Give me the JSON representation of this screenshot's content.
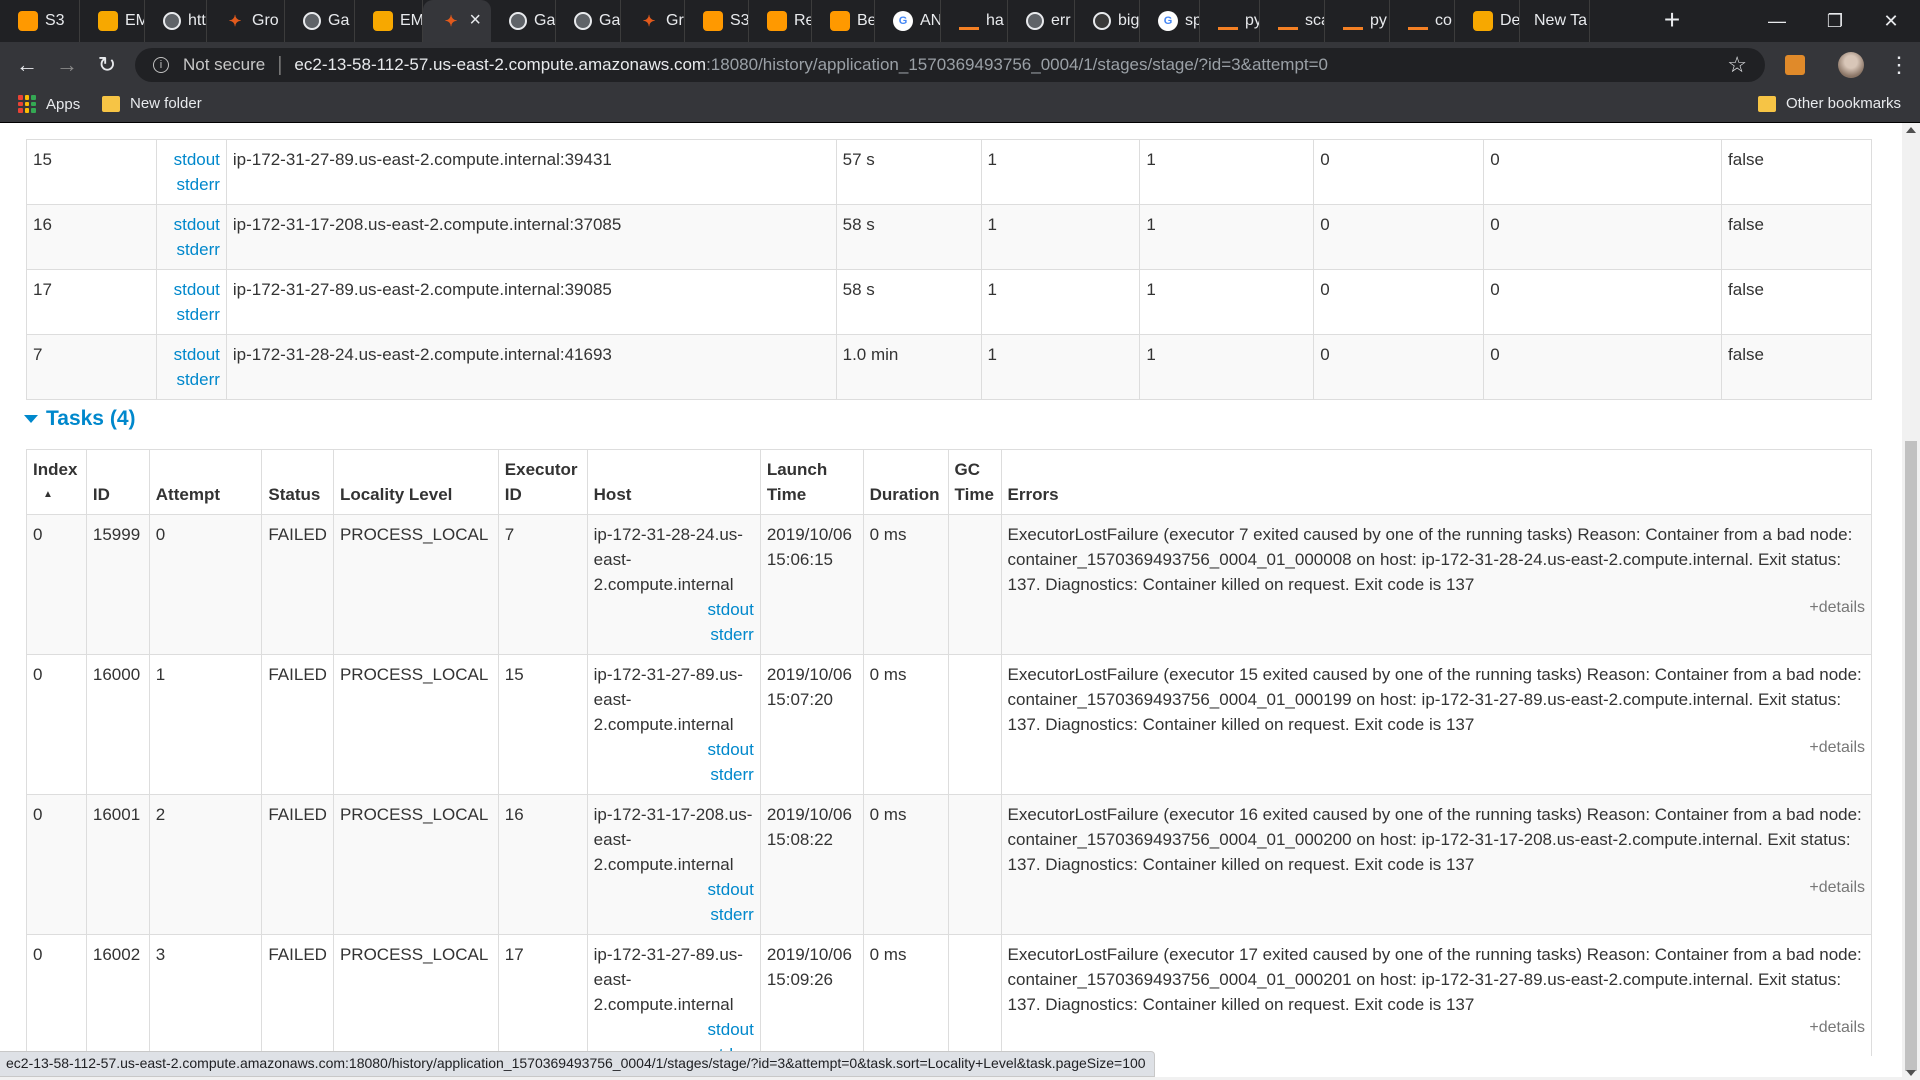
{
  "browser": {
    "tabs": [
      {
        "label": "S3",
        "icon": "aws-icon",
        "color": "#ff9900",
        "glyph": ""
      },
      {
        "label": "EM",
        "icon": "aws-box-icon",
        "color": "#f7a800",
        "glyph": ""
      },
      {
        "label": "htt",
        "icon": "page-icon",
        "color": "#5f6368",
        "glyph": ""
      },
      {
        "label": "Gro",
        "icon": "spark-icon",
        "color": "#e25a1c",
        "glyph": "✦"
      },
      {
        "label": "Ga",
        "icon": "page-icon",
        "color": "#5f6368",
        "glyph": ""
      },
      {
        "label": "EM",
        "icon": "aws-box-icon",
        "color": "#f7a800",
        "glyph": ""
      },
      {
        "label": "",
        "icon": "spark-icon",
        "color": "#e25a1c",
        "glyph": "✦",
        "active": true
      },
      {
        "label": "Ga",
        "icon": "page-icon",
        "color": "#5f6368",
        "glyph": ""
      },
      {
        "label": "Ga",
        "icon": "page-icon",
        "color": "#5f6368",
        "glyph": ""
      },
      {
        "label": "Gr",
        "icon": "spark-icon",
        "color": "#e25a1c",
        "glyph": "✦"
      },
      {
        "label": "S3",
        "icon": "aws-icon",
        "color": "#ff9900",
        "glyph": ""
      },
      {
        "label": "Re",
        "icon": "aws-icon",
        "color": "#ff9900",
        "glyph": ""
      },
      {
        "label": "Be",
        "icon": "aws-icon",
        "color": "#ff9900",
        "glyph": ""
      },
      {
        "label": "AN",
        "icon": "google-icon",
        "color": "#ffffff",
        "glyph": "G"
      },
      {
        "label": "ha",
        "icon": "stack-overflow-icon",
        "color": "#f48024",
        "glyph": ""
      },
      {
        "label": "err",
        "icon": "page-icon",
        "color": "#5f6368",
        "glyph": ""
      },
      {
        "label": "big",
        "icon": "github-icon",
        "color": "#3a3a3a",
        "glyph": ""
      },
      {
        "label": "sp",
        "icon": "google-icon",
        "color": "#ffffff",
        "glyph": "G"
      },
      {
        "label": "py",
        "icon": "stack-overflow-icon",
        "color": "#f48024",
        "glyph": ""
      },
      {
        "label": "sca",
        "icon": "stack-overflow-icon",
        "color": "#f48024",
        "glyph": ""
      },
      {
        "label": "py",
        "icon": "stack-overflow-icon",
        "color": "#f48024",
        "glyph": ""
      },
      {
        "label": "co",
        "icon": "stack-overflow-icon",
        "color": "#f48024",
        "glyph": ""
      },
      {
        "label": "De",
        "icon": "aws-box-icon",
        "color": "#f7a800",
        "glyph": ""
      },
      {
        "label": "New Ta",
        "icon": "",
        "color": "",
        "glyph": ""
      }
    ],
    "security_label": "Not secure",
    "url_host": "ec2-13-58-112-57.us-east-2.compute.amazonaws.com",
    "url_rest": ":18080/history/application_1570369493756_0004/1/stages/stage/?id=3&attempt=0",
    "bookmarks": {
      "apps": "Apps",
      "new_folder": "New folder",
      "other": "Other bookmarks"
    },
    "status_url": "ec2-13-58-112-57.us-east-2.compute.amazonaws.com:18080/history/application_1570369493756_0004/1/stages/stage/?id=3&attempt=0&task.sort=Locality+Level&task.pageSize=100"
  },
  "executors": {
    "rows": [
      {
        "id": "15",
        "stdout": "stdout",
        "stderr": "stderr",
        "address": "ip-172-31-27-89.us-east-2.compute.internal:39431",
        "task_time": "57 s",
        "total_tasks": "1",
        "failed_tasks": "1",
        "killed_tasks": "0",
        "succeeded_tasks": "0",
        "blacklisted": "false"
      },
      {
        "id": "16",
        "stdout": "stdout",
        "stderr": "stderr",
        "address": "ip-172-31-17-208.us-east-2.compute.internal:37085",
        "task_time": "58 s",
        "total_tasks": "1",
        "failed_tasks": "1",
        "killed_tasks": "0",
        "succeeded_tasks": "0",
        "blacklisted": "false"
      },
      {
        "id": "17",
        "stdout": "stdout",
        "stderr": "stderr",
        "address": "ip-172-31-27-89.us-east-2.compute.internal:39085",
        "task_time": "58 s",
        "total_tasks": "1",
        "failed_tasks": "1",
        "killed_tasks": "0",
        "succeeded_tasks": "0",
        "blacklisted": "false"
      },
      {
        "id": "7",
        "stdout": "stdout",
        "stderr": "stderr",
        "address": "ip-172-31-28-24.us-east-2.compute.internal:41693",
        "task_time": "1.0 min",
        "total_tasks": "1",
        "failed_tasks": "1",
        "killed_tasks": "0",
        "succeeded_tasks": "0",
        "blacklisted": "false"
      }
    ]
  },
  "tasks": {
    "title": "Tasks (4)",
    "headers": {
      "index": "Index",
      "sort_arrow": "▲",
      "id": "ID",
      "attempt": "Attempt",
      "status": "Status",
      "locality": "Locality Level",
      "executor_id": "Executor ID",
      "host": "Host",
      "launch_time": "Launch Time",
      "duration": "Duration",
      "gc_time": "GC Time",
      "errors": "Errors"
    },
    "rows": [
      {
        "index": "0",
        "id": "15999",
        "attempt": "0",
        "status": "FAILED",
        "locality": "PROCESS_LOCAL",
        "executor_id": "7",
        "host": "ip-172-31-28-24.us-east-2.compute.internal",
        "stdout": "stdout",
        "stderr": "stderr",
        "launch_time": "2019/10/06 15:06:15",
        "duration": "0 ms",
        "gc_time": "",
        "error": "ExecutorLostFailure (executor 7 exited caused by one of the running tasks) Reason: Container from a bad node: container_1570369493756_0004_01_000008 on host: ip-172-31-28-24.us-east-2.compute.internal. Exit status: 137. Diagnostics: Container killed on request. Exit code is 137",
        "details": "+details"
      },
      {
        "index": "0",
        "id": "16000",
        "attempt": "1",
        "status": "FAILED",
        "locality": "PROCESS_LOCAL",
        "executor_id": "15",
        "host": "ip-172-31-27-89.us-east-2.compute.internal",
        "stdout": "stdout",
        "stderr": "stderr",
        "launch_time": "2019/10/06 15:07:20",
        "duration": "0 ms",
        "gc_time": "",
        "error": "ExecutorLostFailure (executor 15 exited caused by one of the running tasks) Reason: Container from a bad node: container_1570369493756_0004_01_000199 on host: ip-172-31-27-89.us-east-2.compute.internal. Exit status: 137. Diagnostics: Container killed on request. Exit code is 137",
        "details": "+details"
      },
      {
        "index": "0",
        "id": "16001",
        "attempt": "2",
        "status": "FAILED",
        "locality": "PROCESS_LOCAL",
        "executor_id": "16",
        "host": "ip-172-31-17-208.us-east-2.compute.internal",
        "stdout": "stdout",
        "stderr": "stderr",
        "launch_time": "2019/10/06 15:08:22",
        "duration": "0 ms",
        "gc_time": "",
        "error": "ExecutorLostFailure (executor 16 exited caused by one of the running tasks) Reason: Container from a bad node: container_1570369493756_0004_01_000200 on host: ip-172-31-17-208.us-east-2.compute.internal. Exit status: 137. Diagnostics: Container killed on request. Exit code is 137",
        "details": "+details"
      },
      {
        "index": "0",
        "id": "16002",
        "attempt": "3",
        "status": "FAILED",
        "locality": "PROCESS_LOCAL",
        "executor_id": "17",
        "host": "ip-172-31-27-89.us-east-2.compute.internal",
        "stdout": "stdout",
        "stderr": "stderr",
        "launch_time": "2019/10/06 15:09:26",
        "duration": "0 ms",
        "gc_time": "",
        "error": "ExecutorLostFailure (executor 17 exited caused by one of the running tasks) Reason: Container from a bad node: container_1570369493756_0004_01_000201 on host: ip-172-31-27-89.us-east-2.compute.internal. Exit status: 137. Diagnostics: Container killed on request. Exit code is 137",
        "details": "+details"
      }
    ]
  },
  "colors": {
    "link": "#0088cc",
    "chrome_dark": "#202124",
    "chrome_toolbar": "#35363a"
  }
}
